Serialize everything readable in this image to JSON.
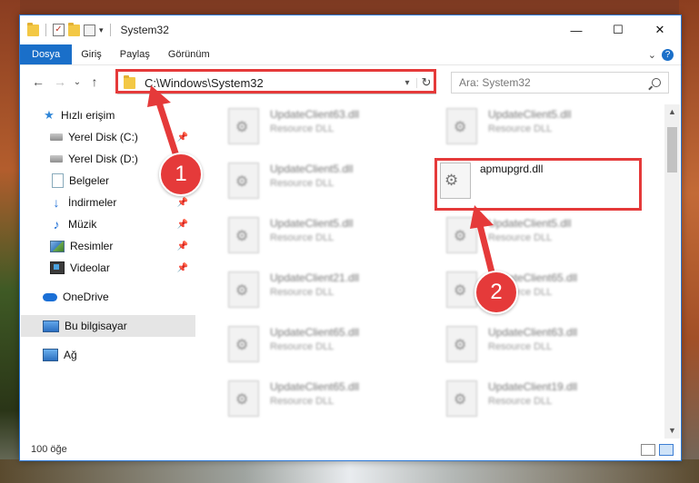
{
  "window": {
    "title": "System32",
    "controls": {
      "minimize": "—",
      "maximize": "☐",
      "close": "✕"
    }
  },
  "ribbon": {
    "tabs": [
      {
        "label": "Dosya",
        "active": true
      },
      {
        "label": "Giriş"
      },
      {
        "label": "Paylaş"
      },
      {
        "label": "Görünüm"
      }
    ],
    "help": "?",
    "expand": "⌄"
  },
  "nav": {
    "back": "←",
    "forward": "→",
    "recent": "⌄",
    "up": "↑",
    "address": "C:\\Windows\\System32",
    "refresh": "↻",
    "search_placeholder": "Ara: System32"
  },
  "sidebar": {
    "items": [
      {
        "label": "Hızlı erişim",
        "icon": "star-icon"
      },
      {
        "label": "Yerel Disk (C:)",
        "icon": "disk-icon",
        "pinned": true
      },
      {
        "label": "Yerel Disk (D:)",
        "icon": "disk-icon",
        "pinned": true
      },
      {
        "label": "Belgeler",
        "icon": "documents-icon"
      },
      {
        "label": "İndirmeler",
        "icon": "download-icon",
        "pinned": true
      },
      {
        "label": "Müzik",
        "icon": "music-icon",
        "pinned": true
      },
      {
        "label": "Resimler",
        "icon": "pictures-icon",
        "pinned": true
      },
      {
        "label": "Videolar",
        "icon": "videos-icon",
        "pinned": true
      },
      {
        "label": "OneDrive",
        "icon": "onedrive-icon"
      },
      {
        "label": "Bu bilgisayar",
        "icon": "computer-icon",
        "selected": true
      },
      {
        "label": "Ağ",
        "icon": "network-icon"
      }
    ],
    "pin_glyph": "📌"
  },
  "files": {
    "left_column": [
      {
        "name": "UpdateClient63.dll",
        "type": "Resource DLL"
      },
      {
        "name": "UpdateClient5.dll",
        "type": "Resource DLL"
      },
      {
        "name": "UpdateClient5.dll",
        "type": "Resource DLL"
      },
      {
        "name": "UpdateClient21.dll",
        "type": "Resource DLL"
      },
      {
        "name": "UpdateClient65.dll",
        "type": "Resource DLL"
      },
      {
        "name": "UpdateClient65.dll",
        "type": "Resource DLL"
      }
    ],
    "right_column": [
      {
        "name": "UpdateClient5.dll",
        "type": "Resource DLL"
      },
      {
        "name": "UpdateClient5.dll",
        "type": "Resource DLL"
      },
      {
        "name": "UpdateClient65.dll",
        "type": "Resource DLL"
      },
      {
        "name": "UpdateClient63.dll",
        "type": "Resource DLL"
      },
      {
        "name": "UpdateClient19.dll",
        "type": "Resource DLL"
      }
    ],
    "highlighted": {
      "name": "apmupgrd.dll"
    }
  },
  "status": {
    "item_count": "100 öğe"
  },
  "annotations": {
    "badge_1": "1",
    "badge_2": "2",
    "color": "#e53a3a"
  }
}
